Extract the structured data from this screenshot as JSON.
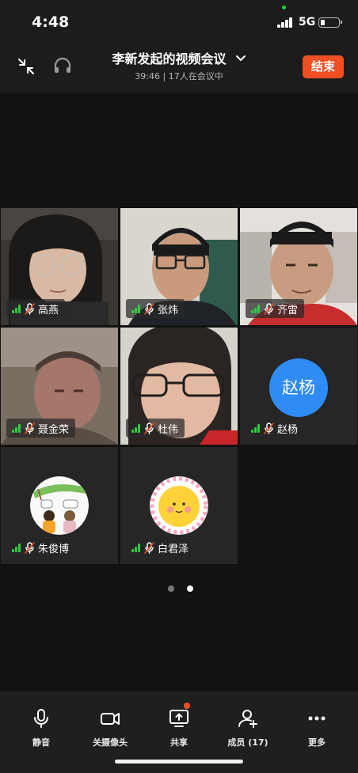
{
  "status_bar": {
    "time": "4:48",
    "network": "5G",
    "battery_level": 0.2
  },
  "header": {
    "title": "李新发起的视频会议",
    "subtitle": "39:46 | 17人在会议中",
    "end_button": "结束",
    "icons": {
      "shrink": "shrink-icon",
      "headset": "headset-icon",
      "dropdown": "chevron-down-icon"
    }
  },
  "participants": [
    {
      "name": "高燕",
      "type": "video",
      "muted": true
    },
    {
      "name": "张炜",
      "type": "video",
      "muted": true
    },
    {
      "name": "齐雷",
      "type": "video",
      "muted": true
    },
    {
      "name": "聂金荣",
      "type": "video",
      "muted": true
    },
    {
      "name": "杜伟",
      "type": "video",
      "muted": true
    },
    {
      "name": "赵杨",
      "type": "avatar-text",
      "avatar_text": "赵杨",
      "avatar_color": "#2f8cf5",
      "muted": true
    },
    {
      "name": "朱俊博",
      "type": "avatar-image",
      "muted": true
    },
    {
      "name": "白君泽",
      "type": "avatar-image",
      "muted": true
    }
  ],
  "pagination": {
    "pages": 2,
    "current": 2
  },
  "toolbar": {
    "mute": "静音",
    "camera_off": "关摄像头",
    "share": "共享",
    "members": "成员 (17)",
    "more": "更多"
  },
  "colors": {
    "accent_end": "#f04e23",
    "signal_green": "#2ecc40",
    "avatar_blue": "#2f8cf5"
  }
}
